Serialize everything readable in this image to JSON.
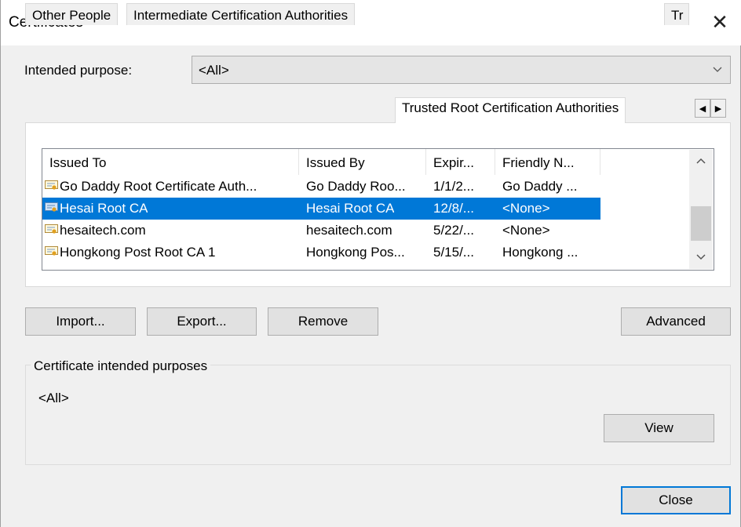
{
  "window": {
    "title": "Certificates",
    "close_glyph": "✕"
  },
  "purpose": {
    "label": "Intended purpose:",
    "selected": "<All>"
  },
  "tabs": [
    {
      "label": "Other People"
    },
    {
      "label": "Intermediate Certification Authorities"
    },
    {
      "label": "Trusted Root Certification Authorities"
    },
    {
      "label": "Tr"
    }
  ],
  "list": {
    "columns": [
      "Issued To",
      "Issued By",
      "Expir...",
      "Friendly N..."
    ],
    "rows": [
      {
        "issued_to": "Go Daddy Root Certificate Auth...",
        "issued_by": "Go Daddy Roo...",
        "expiration": "1/1/2...",
        "friendly": "Go Daddy ..."
      },
      {
        "issued_to": "Hesai Root CA",
        "issued_by": "Hesai Root CA",
        "expiration": "12/8/...",
        "friendly": "<None>"
      },
      {
        "issued_to": "hesaitech.com",
        "issued_by": "hesaitech.com",
        "expiration": "5/22/...",
        "friendly": "<None>"
      },
      {
        "issued_to": "Hongkong Post Root CA 1",
        "issued_by": "Hongkong Pos...",
        "expiration": "5/15/...",
        "friendly": "Hongkong ..."
      }
    ]
  },
  "buttons": {
    "import": "Import...",
    "export": "Export...",
    "remove": "Remove",
    "advanced": "Advanced",
    "view": "View",
    "close": "Close"
  },
  "purposes_group": {
    "title": "Certificate intended purposes",
    "value": "<All>"
  },
  "colors": {
    "selection": "#0078d7",
    "background": "#f0f0f0"
  }
}
